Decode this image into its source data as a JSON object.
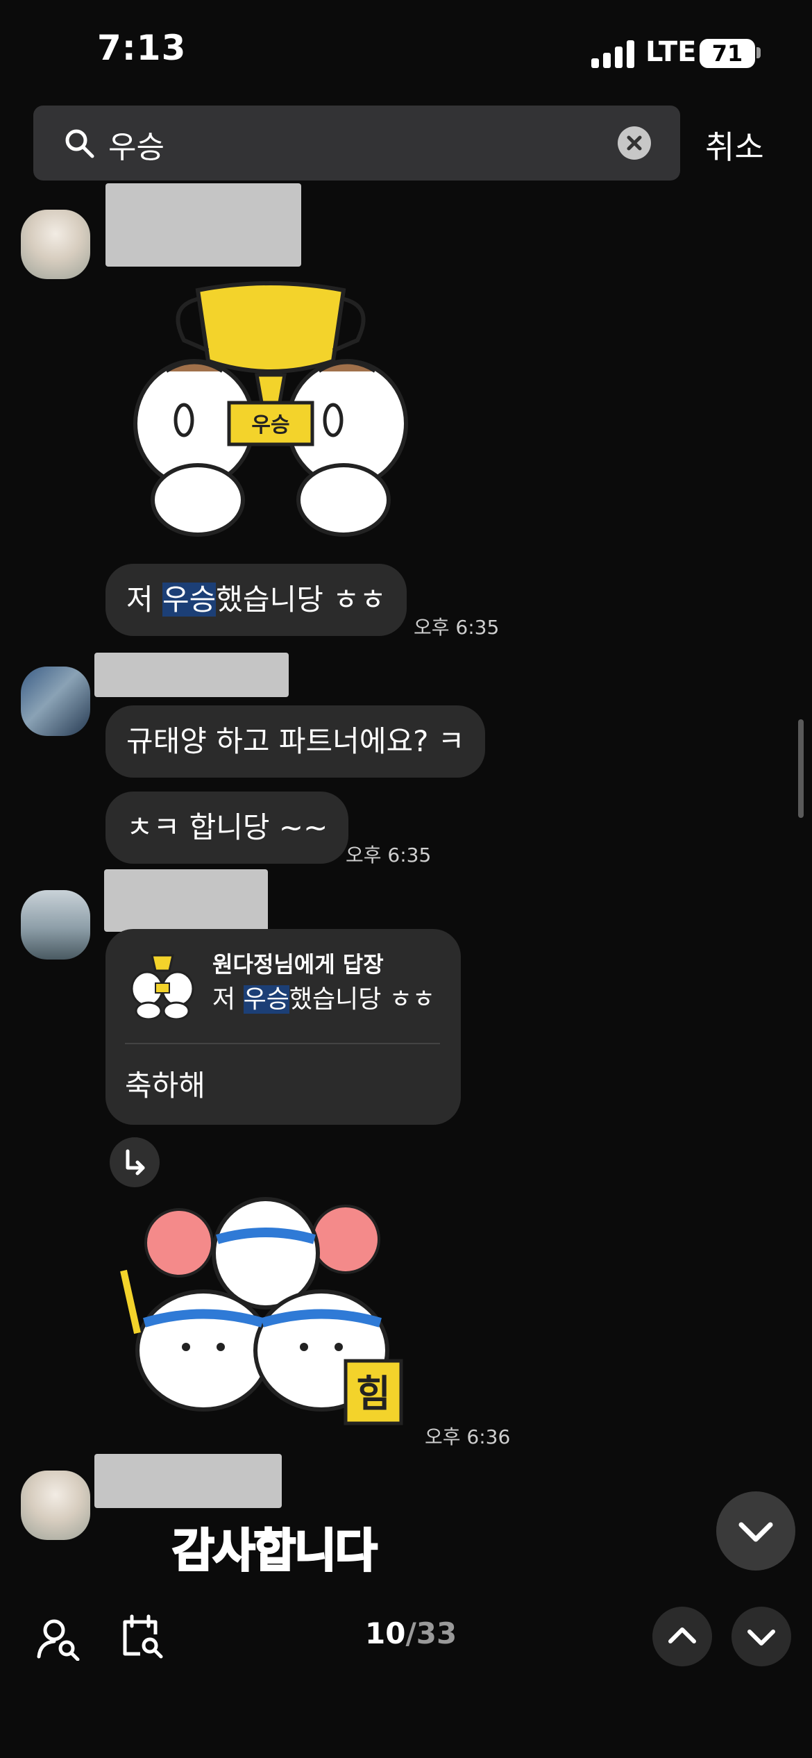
{
  "status": {
    "time": "7:13",
    "carrier": "LTE",
    "battery": "71"
  },
  "search": {
    "query": "우승",
    "cancel_label": "취소"
  },
  "messages": {
    "m1": {
      "before": "저 ",
      "highlight": "우승",
      "after": "했습니당 ㅎㅎ",
      "time": "오후 6:35"
    },
    "m2": {
      "text": "규태양 하고 파트너에요? ㅋ"
    },
    "m3": {
      "text": "ㅊㅋ 합니당 ~~",
      "time": "오후 6:35"
    },
    "reply": {
      "title": "원다정님에게 답장",
      "quote_before": "저 ",
      "quote_highlight": "우승",
      "quote_after": "했습니당 ㅎㅎ",
      "message": "축하해"
    },
    "sticker_time": "오후 6:36",
    "last_sticker_text": "감사합니다"
  },
  "sticker_labels": {
    "trophy_sign": "우승",
    "cheer_sign": "힘"
  },
  "bottom_bar": {
    "current": "10",
    "separator": "/",
    "total": "33"
  },
  "colors": {
    "background": "#0b0b0b",
    "bubble": "#2b2b2b",
    "highlight": "#1c3f76",
    "search_bar": "#333335"
  }
}
